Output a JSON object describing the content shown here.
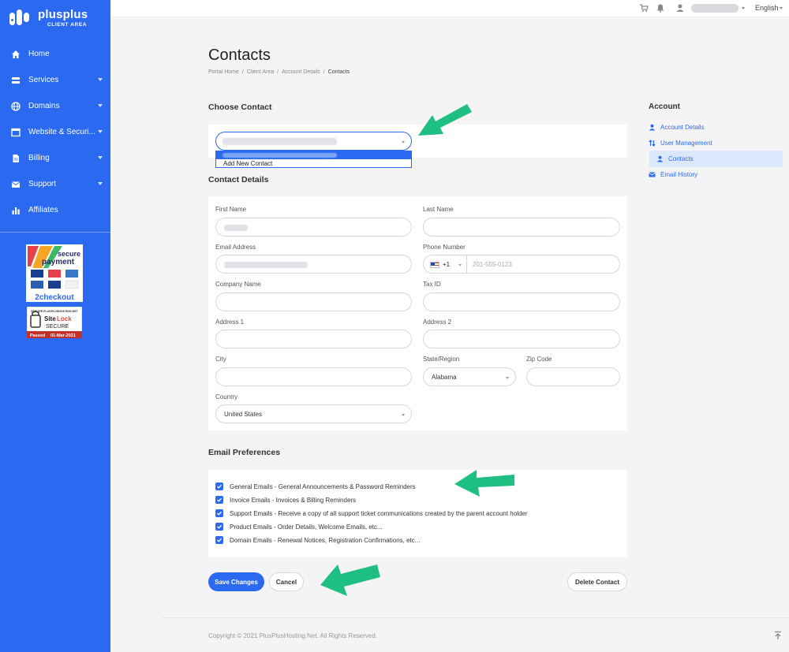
{
  "brand": {
    "name": "plusplus",
    "subtitle": "CLIENT AREA"
  },
  "sidebar": {
    "items": [
      {
        "label": "Home",
        "icon": "home-icon",
        "has_submenu": false
      },
      {
        "label": "Services",
        "icon": "server-icon",
        "has_submenu": true
      },
      {
        "label": "Domains",
        "icon": "globe-icon",
        "has_submenu": true
      },
      {
        "label": "Website & Securi...",
        "icon": "browser-icon",
        "has_submenu": true
      },
      {
        "label": "Billing",
        "icon": "document-icon",
        "has_submenu": true
      },
      {
        "label": "Support",
        "icon": "mail-icon",
        "has_submenu": true
      },
      {
        "label": "Affiliates",
        "icon": "bar-chart-icon",
        "has_submenu": false
      }
    ],
    "badges": {
      "secure_payment": {
        "line1": "secure",
        "line2": "payment",
        "brand": "2checkout"
      },
      "sitelock": {
        "top": "SECURE.PLUSPLUSHOSTING.NET",
        "name1": "Site",
        "name2": "Lock",
        "secure": "SECURE",
        "passed": "Passed",
        "date": "01-Mar-2021"
      }
    }
  },
  "topbar": {
    "language": "English"
  },
  "page": {
    "title": "Contacts",
    "breadcrumb": [
      "Portal Home",
      "Client Area",
      "Account Details",
      "Contacts"
    ]
  },
  "choose_contact": {
    "heading": "Choose Contact",
    "dropdown_option": "Add New Contact"
  },
  "contact_details": {
    "heading": "Contact Details",
    "labels": {
      "first_name": "First Name",
      "last_name": "Last Name",
      "email": "Email Address",
      "phone": "Phone Number",
      "company": "Company Name",
      "tax_id": "Tax ID",
      "address1": "Address 1",
      "address2": "Address 2",
      "city": "City",
      "state": "State/Region",
      "zip": "Zip Code",
      "country": "Country"
    },
    "phone_code": "+1",
    "phone_placeholder": "201-555-0123",
    "state_value": "Alabama",
    "country_value": "United States"
  },
  "email_preferences": {
    "heading": "Email Preferences",
    "items": [
      {
        "label": "General Emails - General Announcements & Password Reminders",
        "checked": true
      },
      {
        "label": "Invoice Emails - Invoices & Billing Reminders",
        "checked": true
      },
      {
        "label": "Support Emails - Receive a copy of all support ticket communications created by the parent account holder",
        "checked": true
      },
      {
        "label": "Product Emails - Order Details, Welcome Emails, etc...",
        "checked": true
      },
      {
        "label": "Domain Emails - Renewal Notices, Registration Confirmations, etc...",
        "checked": true
      }
    ]
  },
  "buttons": {
    "save": "Save Changes",
    "cancel": "Cancel",
    "delete": "Delete Contact"
  },
  "account_nav": {
    "title": "Account",
    "items": [
      {
        "label": "Account Details",
        "icon": "user-icon",
        "active": false
      },
      {
        "label": "User Management",
        "icon": "users-arrows-icon",
        "active": false
      },
      {
        "label": "Contacts",
        "icon": "user-icon",
        "active": true
      },
      {
        "label": "Email History",
        "icon": "envelope-icon",
        "active": false
      }
    ]
  },
  "footer": {
    "copyright": "Copyright © 2021 PlusPlusHosting.Net. All Rights Reserved."
  },
  "colors": {
    "primary": "#2b6af0",
    "arrow": "#1fbf84",
    "active_bg": "#dbe8fc"
  }
}
